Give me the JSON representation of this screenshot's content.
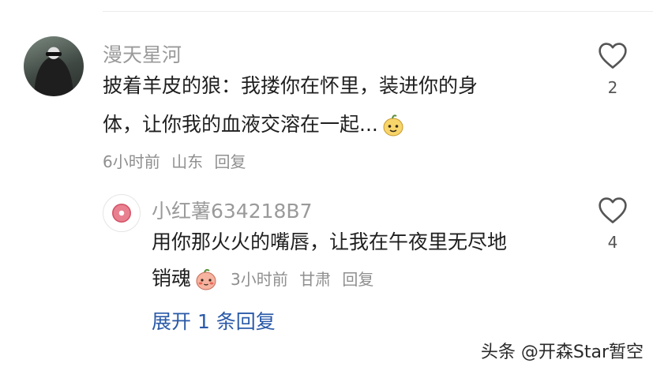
{
  "comment": {
    "username": "漫天星河",
    "text_line1": "披着羊皮的狼：我搂你在怀里，装进你的身",
    "text_line2": "体，让你我的血液交溶在一起...",
    "time": "6小时前",
    "location": "山东",
    "reply_label": "回复",
    "like_count": "2",
    "emoji_icon": "smirk-sticker-emoji"
  },
  "reply": {
    "username": "小红薯634218B7",
    "text_line1": "用你那火火的嘴唇，让我在午夜里无尽地",
    "text_line2": "销魂",
    "time": "3小时前",
    "location": "甘肃",
    "reply_label": "回复",
    "like_count": "4",
    "emoji_icon": "blush-sticker-emoji"
  },
  "expand_replies_label": "展开 1 条回复",
  "watermark": "头条 @开森Star暂空"
}
